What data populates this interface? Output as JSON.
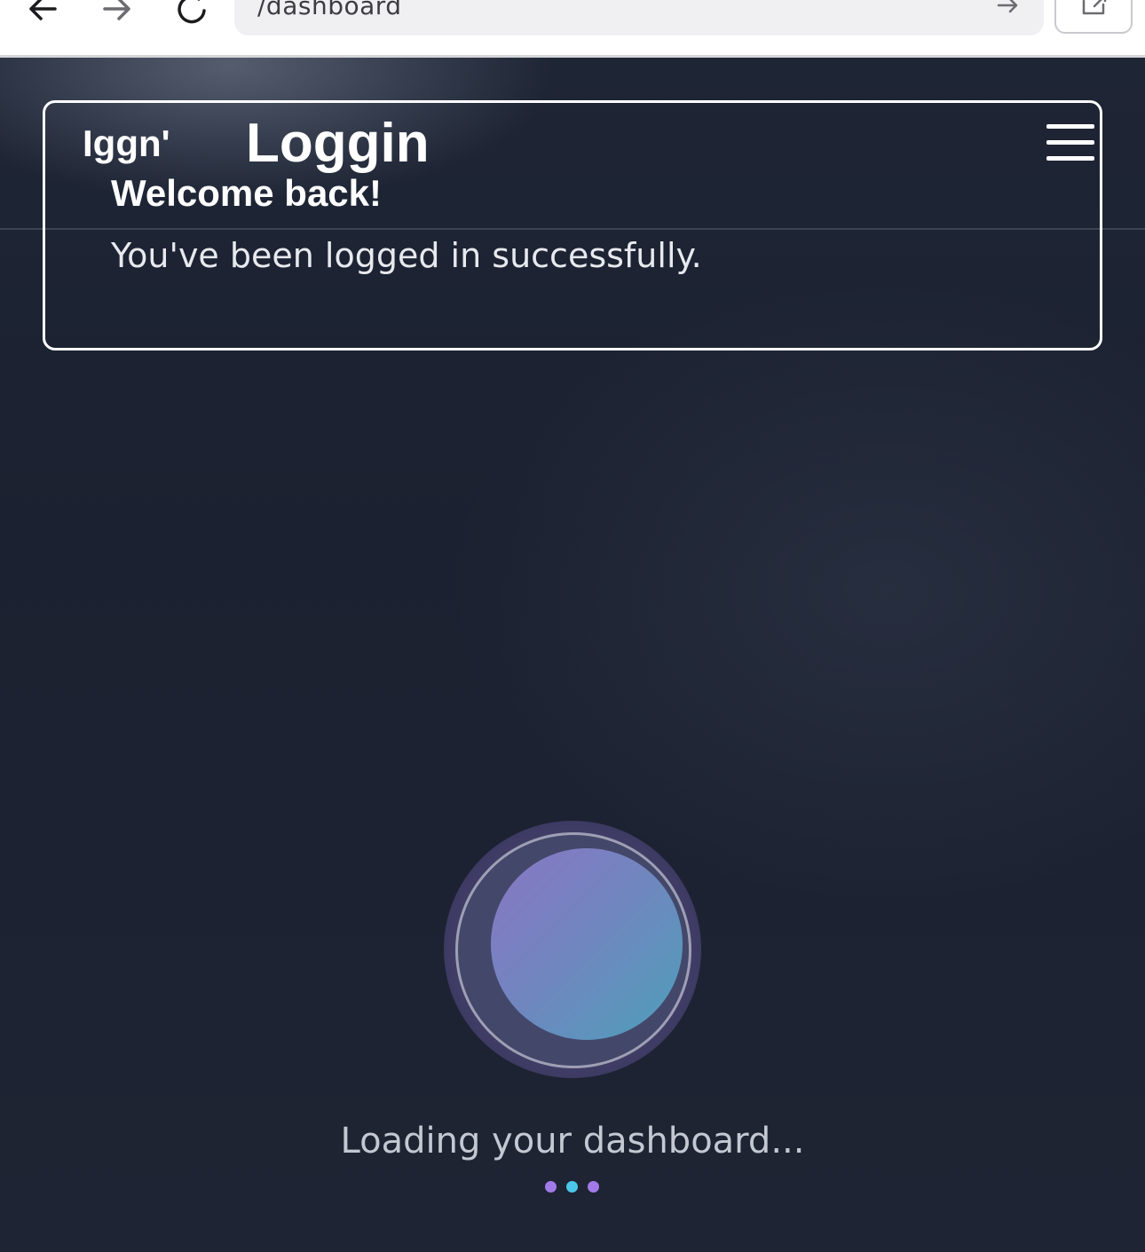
{
  "browser": {
    "url": "/dashboard",
    "back_icon": "back-arrow-icon",
    "forward_icon": "forward-arrow-icon",
    "reload_icon": "reload-icon",
    "go_icon": "go-arrow-icon",
    "share_icon": "share-icon"
  },
  "header": {
    "logo": "Iggn'",
    "title": "Loggin",
    "menu_icon": "hamburger-menu-icon"
  },
  "notice": {
    "heading": "Welcome back!",
    "message": "You've been logged in successfully."
  },
  "loader": {
    "text": "Loading your dashboard...",
    "dot_colors": [
      "#a27ae8",
      "#4cc6e8",
      "#a27ae8"
    ]
  },
  "colors": {
    "background": "#1c2232",
    "orb_start": "#8a76c4",
    "orb_end": "#4d9fba"
  }
}
